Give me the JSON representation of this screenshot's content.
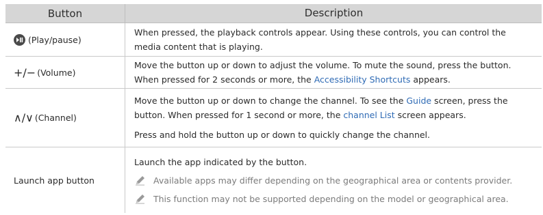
{
  "header": {
    "col_button": "Button",
    "col_description": "Description"
  },
  "rows": [
    {
      "label": "(Play/pause)",
      "icon": "play-pause-icon",
      "description": "When pressed, the playback controls appear. Using these controls, you can control the media content that is playing."
    },
    {
      "label_symbol": "+/−",
      "label": "(Volume)",
      "desc_part1": "Move the button up or down to adjust the volume. To mute the sound, press the button. When pressed for 2 seconds or more, the ",
      "desc_link": "Accessibility Shortcuts",
      "desc_part2": " appears."
    },
    {
      "label_symbol": "∧/∨",
      "label": "(Channel)",
      "p1_part1": "Move the button up or down to change the channel. To see the ",
      "p1_link1": "Guide",
      "p1_part2": " screen, press the button. When pressed for 1 second or more, the ",
      "p1_link2": "channel List",
      "p1_part3": " screen appears.",
      "p2": "Press and hold the button up or down to quickly change the channel."
    },
    {
      "label": "Launch app button",
      "description": "Launch the app indicated by the button.",
      "notes": [
        "Available apps may differ depending on the geographical area or contents provider.",
        "This function may not be supported depending on the model or geographical area."
      ],
      "note_icon": "pencil-icon"
    }
  ],
  "colors": {
    "header_bg": "#d6d6d6",
    "link": "#2f6bb5",
    "note_text": "#7b7b7b"
  }
}
